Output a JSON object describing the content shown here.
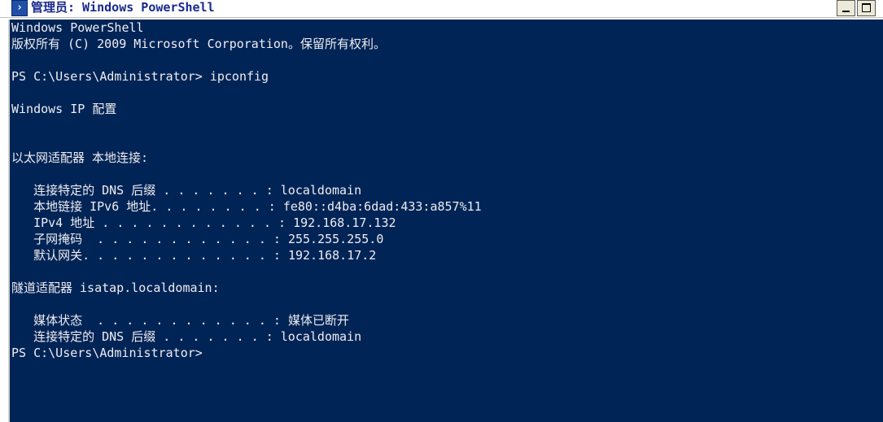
{
  "window": {
    "title": "管理员: Windows PowerShell",
    "icon": "powershell-icon",
    "controls": [
      "minimize-icon",
      "maximize-icon"
    ]
  },
  "colors": {
    "console_background": "#012456",
    "console_text": "#eeedf0",
    "title_text": "#1a2a8c"
  },
  "console": {
    "lines": [
      "Windows PowerShell",
      "版权所有 (C) 2009 Microsoft Corporation。保留所有权利。",
      "",
      "PS C:\\Users\\Administrator> ipconfig",
      "",
      "Windows IP 配置",
      "",
      "",
      "以太网适配器 本地连接:",
      "",
      "   连接特定的 DNS 后缀 . . . . . . . : localdomain",
      "   本地链接 IPv6 地址. . . . . . . . : fe80::d4ba:6dad:433:a857%11",
      "   IPv4 地址 . . . . . . . . . . . . : 192.168.17.132",
      "   子网掩码  . . . . . . . . . . . . : 255.255.255.0",
      "   默认网关. . . . . . . . . . . . . : 192.168.17.2",
      "",
      "隧道适配器 isatap.localdomain:",
      "",
      "   媒体状态  . . . . . . . . . . . . : 媒体已断开",
      "   连接特定的 DNS 后缀 . . . . . . . : localdomain",
      "PS C:\\Users\\Administrator>"
    ]
  }
}
